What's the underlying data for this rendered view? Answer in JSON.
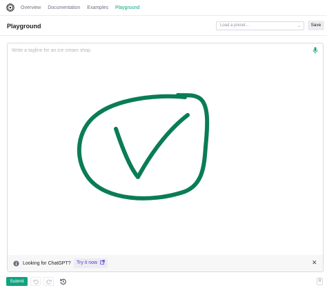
{
  "nav": {
    "links": [
      "Overview",
      "Documentation",
      "Examples",
      "Playground"
    ],
    "active_index": 3
  },
  "header": {
    "title": "Playground",
    "preset_placeholder": "Load a preset...",
    "save_label": "Save"
  },
  "editor": {
    "placeholder": "Write a tagline for an ice cream shop.",
    "drawing_color": "#0a7c57"
  },
  "banner": {
    "text": "Looking for ChatGPT?",
    "link_label": "Try it now"
  },
  "bottom": {
    "submit_label": "Submit",
    "token_count": "0"
  },
  "colors": {
    "accent": "#10a37f",
    "link": "#5436da"
  },
  "icons": [
    "openai-logo-icon",
    "chevron-down-icon",
    "microphone-icon",
    "info-icon",
    "external-link-icon",
    "close-icon",
    "undo-icon",
    "redo-icon",
    "history-icon"
  ]
}
